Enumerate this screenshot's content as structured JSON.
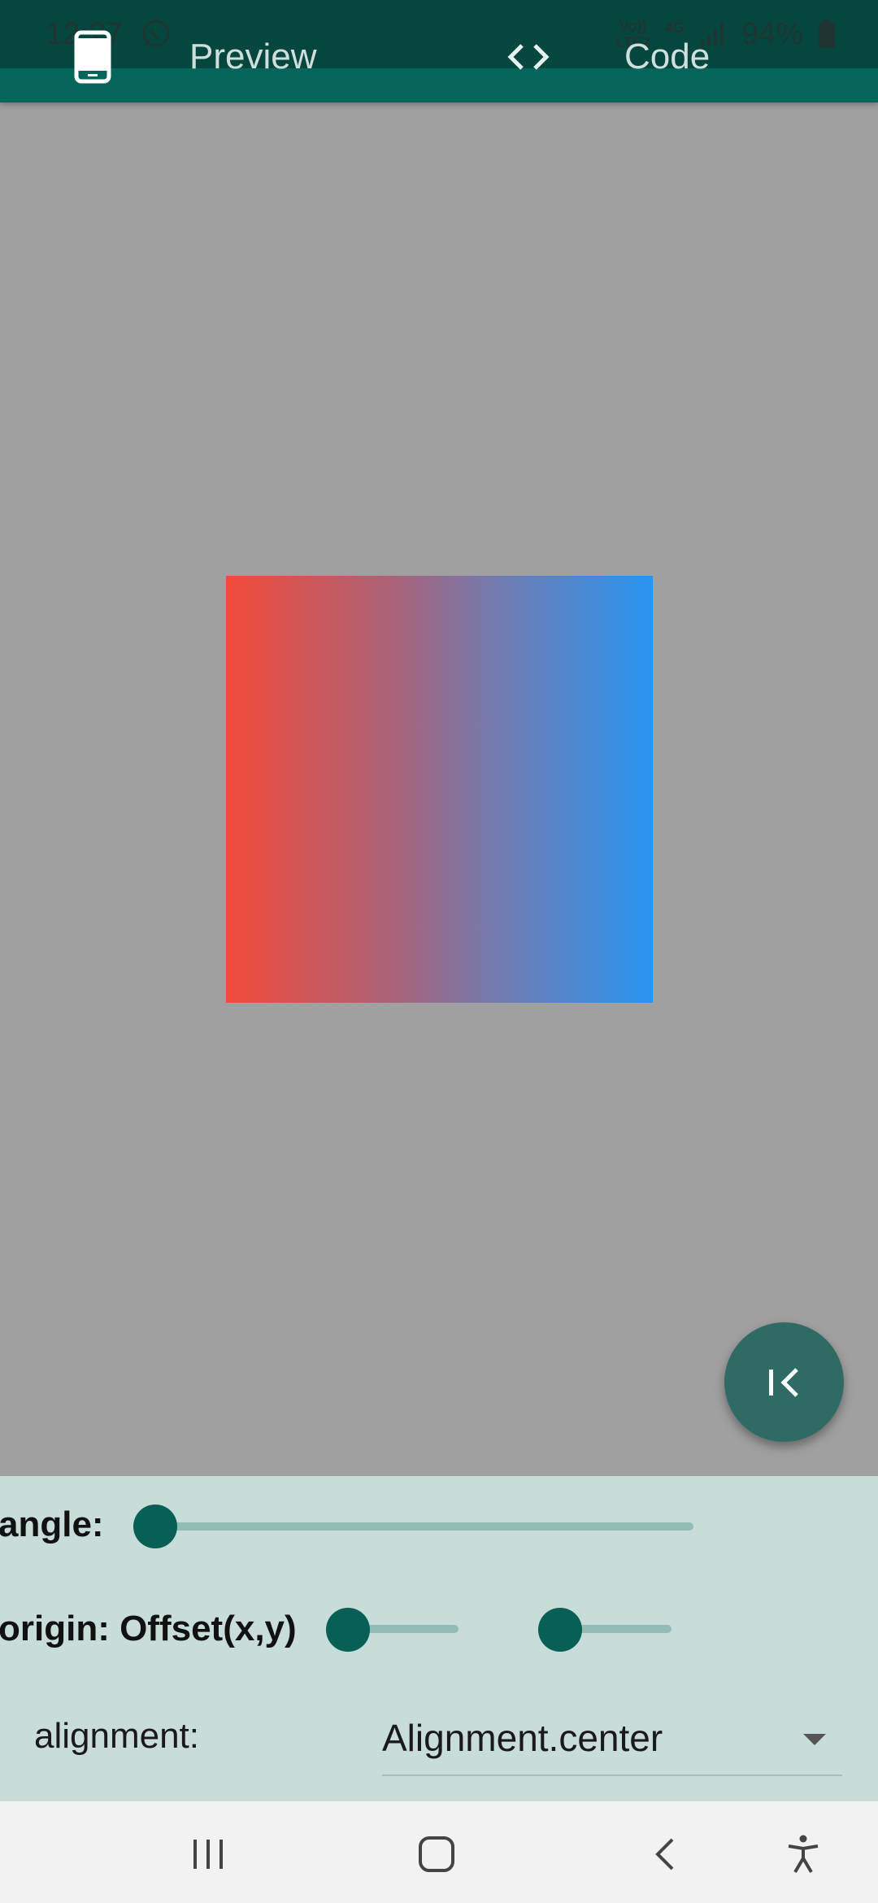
{
  "status_bar": {
    "time": "12:27",
    "network_top": "Vo))",
    "network_bottom": "LTE2",
    "network_type": "4G",
    "battery": "94%",
    "icons": [
      "whatsapp-icon",
      "signal-icon",
      "battery-icon"
    ]
  },
  "tabs": [
    {
      "label": "Preview",
      "icon": "phone-icon"
    },
    {
      "label": "Code",
      "icon": "code-icon"
    }
  ],
  "preview": {
    "gradient": {
      "start_color": "#f24a3a",
      "end_color": "#2894f0"
    }
  },
  "fab": {
    "icon": "collapse-left-icon"
  },
  "controls": {
    "angle": {
      "label": "angle:",
      "value": 0
    },
    "origin": {
      "label": "origin: Offset(x,y)",
      "x": 0,
      "y": 0
    },
    "alignment": {
      "label": "alignment:",
      "value": "Alignment.center"
    }
  },
  "nav": [
    "recents-icon",
    "home-icon",
    "back-icon",
    "accessibility-icon"
  ],
  "colors": {
    "accent": "#06655a",
    "panel": "#c8dcd9",
    "preview_bg": "#a0a0a0"
  }
}
